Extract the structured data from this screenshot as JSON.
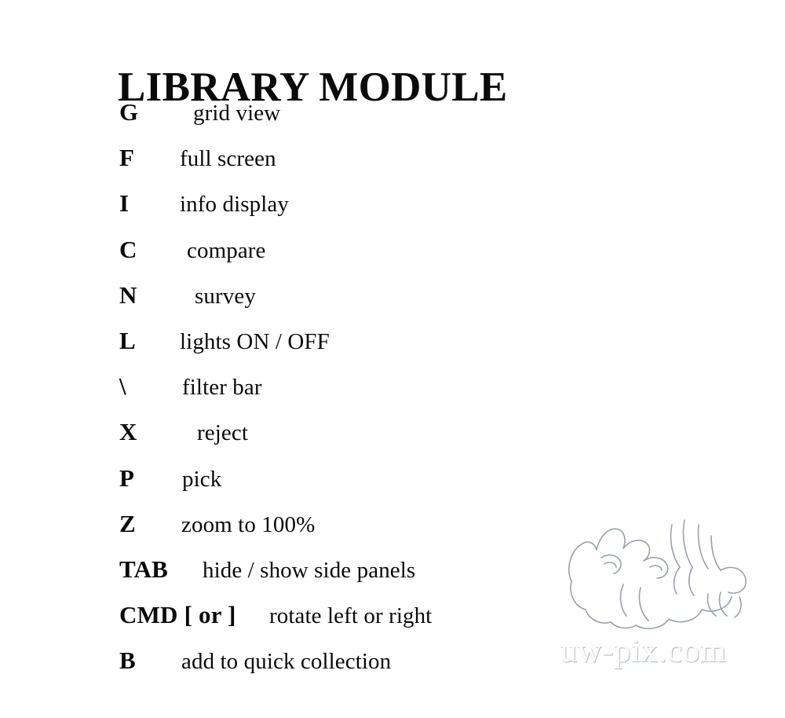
{
  "document": {
    "title": "LIBRARY MODULE",
    "background_color": "#ffffff",
    "text_color": "#0a0a0a"
  },
  "shortcuts": [
    {
      "key": "G",
      "description": "grid view"
    },
    {
      "key": "F",
      "description": "full screen"
    },
    {
      "key": "I",
      "description": "info display"
    },
    {
      "key": "C",
      "description": "compare"
    },
    {
      "key": "N",
      "description": "survey"
    },
    {
      "key": "L",
      "description": "lights ON / OFF"
    },
    {
      "key": "\\",
      "description": "filter bar"
    },
    {
      "key": "X",
      "description": "reject"
    },
    {
      "key": "P",
      "description": "pick"
    },
    {
      "key": "Z",
      "description": "zoom to 100%"
    },
    {
      "key": "TAB",
      "description": "hide / show side panels"
    },
    {
      "key": "CMD [ or ]",
      "description": "rotate left or right"
    },
    {
      "key": "B",
      "description": "add to quick collection"
    }
  ],
  "watermark": {
    "text": "uw-pix.com",
    "logo_name": "embossed-line-art-logo",
    "color": "#fbfbfc",
    "shadow_color": "#b9bec6"
  }
}
